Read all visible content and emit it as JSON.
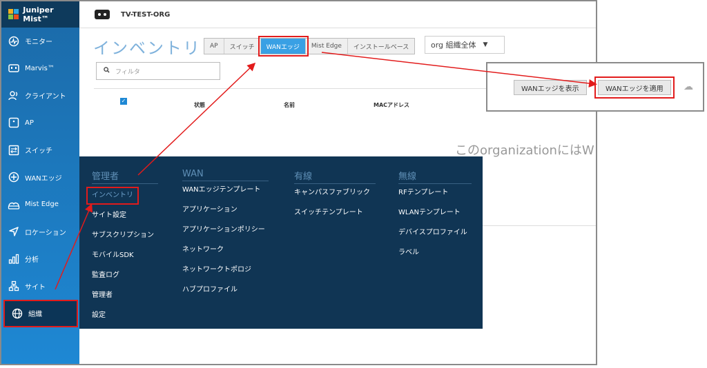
{
  "brand": {
    "logo_text": "Juniper Mist™",
    "colors": {
      "sidebar_top": "#1b6aa8",
      "sidebar_bottom": "#1e88d4",
      "menu_bg": "#103554",
      "accent": "#39a0e4",
      "highlight": "#e21b1b"
    }
  },
  "sidebar": {
    "items": [
      {
        "label": "モニター",
        "icon": "monitor-icon"
      },
      {
        "label": "Marvis™",
        "icon": "marvis-icon"
      },
      {
        "label": "クライアント",
        "icon": "clients-icon"
      },
      {
        "label": "AP",
        "icon": "ap-icon"
      },
      {
        "label": "スイッチ",
        "icon": "switch-icon"
      },
      {
        "label": "WANエッジ",
        "icon": "wan-edge-icon"
      },
      {
        "label": "Mist Edge",
        "icon": "mist-edge-icon"
      },
      {
        "label": "ロケーション",
        "icon": "location-icon"
      },
      {
        "label": "分析",
        "icon": "analytics-icon"
      },
      {
        "label": "サイト",
        "icon": "site-icon"
      },
      {
        "label": "組織",
        "icon": "globe-icon"
      }
    ]
  },
  "topbar": {
    "org_name": "TV-TEST-ORG"
  },
  "page": {
    "title": "インベントリ",
    "tabs": [
      "AP",
      "スイッチ",
      "WANエッジ",
      "Mist Edge",
      "インストールベース"
    ],
    "active_tab": "WANエッジ",
    "org_select": "org 組織全体",
    "filter_placeholder": "フィルタ",
    "columns": [
      "状態",
      "名前",
      "MACアドレス"
    ],
    "empty_text": "このorganizationにはW"
  },
  "callout": {
    "buttons": [
      "WANエッジを表示",
      "WANエッジを適用"
    ]
  },
  "org_menu": {
    "columns": [
      {
        "header": "管理者",
        "items": [
          "インベントリ",
          "サイト設定",
          "サブスクリプション",
          "モバイルSDK",
          "監査ログ",
          "管理者",
          "設定"
        ]
      },
      {
        "header": "WAN",
        "items": [
          "WANエッジテンプレート",
          "アプリケーション",
          "アプリケーションポリシー",
          "ネットワーク",
          "ネットワークトポロジ",
          "ハブプロファイル"
        ]
      },
      {
        "header": "有線",
        "items": [
          "キャンパスファブリック",
          "スイッチテンプレート"
        ]
      },
      {
        "header": "無線",
        "items": [
          "RFテンプレート",
          "WLANテンプレート",
          "デバイスプロファイル",
          "ラベル"
        ]
      }
    ]
  }
}
